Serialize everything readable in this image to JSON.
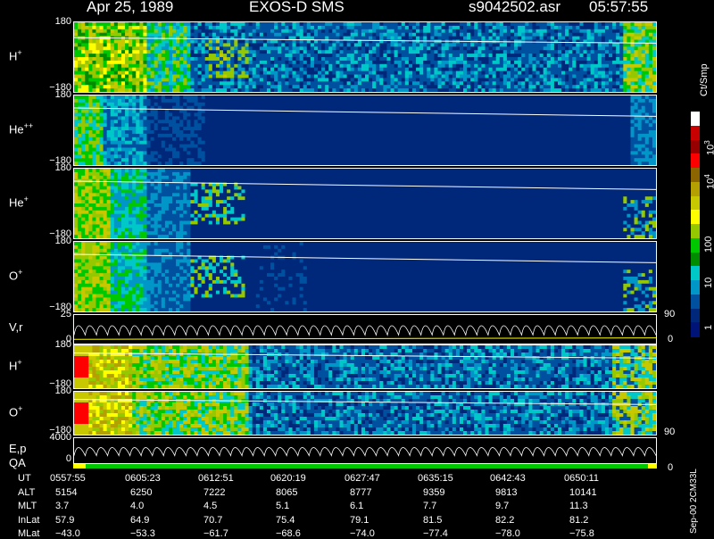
{
  "header": {
    "date": "Apr 25, 1989",
    "mission": "EXOS-D SMS",
    "file": "s9042502.asr",
    "time": "05:57:55"
  },
  "panels": [
    {
      "label": "H",
      "sup": "+",
      "ytop": "180",
      "ybot": "−180"
    },
    {
      "label": "He",
      "sup": "++",
      "ytop": "180",
      "ybot": "−180"
    },
    {
      "label": "He",
      "sup": "+",
      "ytop": "180",
      "ybot": "−180"
    },
    {
      "label": "O",
      "sup": "+",
      "ytop": "180",
      "ybot": "−180"
    },
    {
      "label": "V,r",
      "sup": "",
      "ytop": "25",
      "ybot": "0",
      "rtop": "90",
      "rbot": "0"
    },
    {
      "label": "H",
      "sup": "+",
      "ytop": "180",
      "ybot": "−180"
    },
    {
      "label": "O",
      "sup": "+",
      "ytop": "180",
      "ybot": "−180"
    },
    {
      "label": "E,p",
      "sup": "",
      "ytop": "4000",
      "ybot": "0",
      "rtop": "90",
      "rbot": "0"
    }
  ],
  "qa_label": "QA",
  "colorbar": {
    "units": "Ct/Smp",
    "ticks": [
      "10",
      "100",
      "10",
      "10",
      "1"
    ],
    "tick_exps": [
      "4",
      "",
      "3",
      "",
      ""
    ],
    "colors": [
      "#ffffff",
      "#c80000",
      "#960000",
      "#ff0000",
      "#8c6400",
      "#b4a000",
      "#c8c800",
      "#ffff00",
      "#96c800",
      "#00c800",
      "#008c00",
      "#00c8c8",
      "#0096c8",
      "#0050a0",
      "#00287a",
      "#001478"
    ]
  },
  "footer": {
    "row_labels": [
      "UT",
      "ALT",
      "MLT",
      "InLat",
      "MLat"
    ],
    "columns": [
      {
        "UT": "0557:55",
        "ALT": "5154",
        "MLT": "3.7",
        "InLat": "57.9",
        "MLat": "−43.0"
      },
      {
        "UT": "0605:23",
        "ALT": "6250",
        "MLT": "4.0",
        "InLat": "64.9",
        "MLat": "−53.3"
      },
      {
        "UT": "0612:51",
        "ALT": "7222",
        "MLT": "4.5",
        "InLat": "70.7",
        "MLat": "−61.7"
      },
      {
        "UT": "0620:19",
        "ALT": "8065",
        "MLT": "5.1",
        "InLat": "75.4",
        "MLat": "−68.6"
      },
      {
        "UT": "0627:47",
        "ALT": "8777",
        "MLT": "6.1",
        "InLat": "79.1",
        "MLat": "−74.0"
      },
      {
        "UT": "0635:15",
        "ALT": "9359",
        "MLT": "7.7",
        "InLat": "81.5",
        "MLat": "−77.4"
      },
      {
        "UT": "0642:43",
        "ALT": "9813",
        "MLT": "9.7",
        "InLat": "82.2",
        "MLat": "−78.0"
      },
      {
        "UT": "0650:11",
        "ALT": "10141",
        "MLT": "11.3",
        "InLat": "81.2",
        "MLat": "−75.8"
      }
    ],
    "side_stamp": "Sep-00 2CM33L"
  },
  "chart_data": {
    "type": "heatmap",
    "title": "Apr 25, 1989   EXOS-D SMS",
    "x_axis": {
      "label": "UT",
      "ticks": [
        "0557:55",
        "0605:23",
        "0612:51",
        "0620:19",
        "0627:47",
        "0635:15",
        "0642:43",
        "0650:11"
      ]
    },
    "colorbar_range": [
      1,
      10000
    ],
    "colorbar_scale": "log",
    "series": [
      {
        "name": "H+",
        "ylim": [
          -180,
          180
        ]
      },
      {
        "name": "He++",
        "ylim": [
          -180,
          180
        ]
      },
      {
        "name": "He+",
        "ylim": [
          -180,
          180
        ]
      },
      {
        "name": "O+",
        "ylim": [
          -180,
          180
        ]
      },
      {
        "name": "V,r",
        "ylim": [
          0,
          25
        ],
        "y2lim": [
          0,
          90
        ]
      },
      {
        "name": "H+",
        "ylim": [
          -180,
          180
        ]
      },
      {
        "name": "O+",
        "ylim": [
          -180,
          180
        ]
      },
      {
        "name": "E,p",
        "ylim": [
          0,
          4000
        ],
        "y2lim": [
          0,
          90
        ]
      }
    ]
  }
}
